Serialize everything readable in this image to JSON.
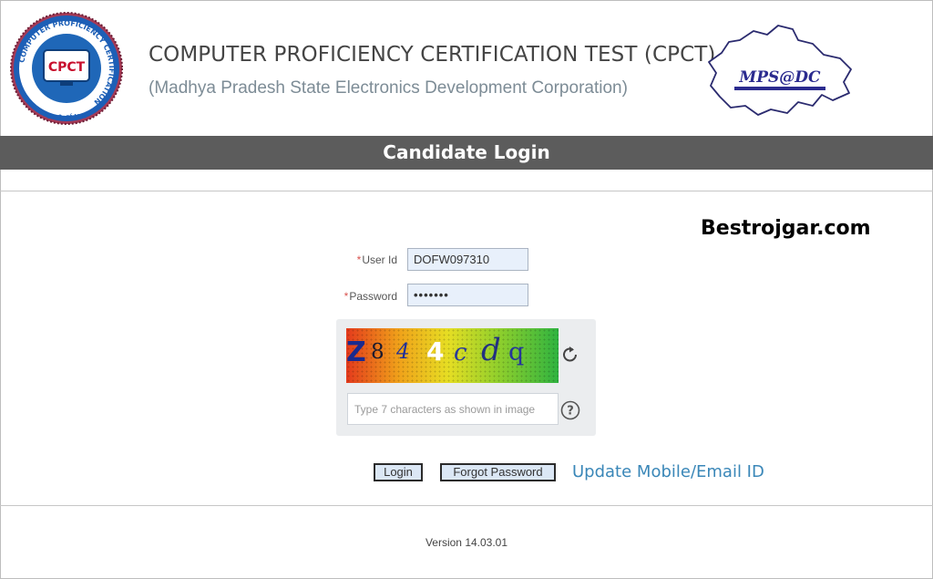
{
  "header": {
    "title": "COMPUTER PROFICIENCY CERTIFICATION TEST (CPCT)",
    "subtitle": "(Madhya Pradesh State Electronics Development Corporation)",
    "left_logo": {
      "ring_text": "COMPUTER PROFICIENCY CERTIFICATION",
      "bottom_text": "Govt. of M.P.",
      "acronym": "CPCT"
    },
    "right_logo": {
      "acronym": "MPS@DC"
    }
  },
  "banner": {
    "title": "Candidate Login"
  },
  "watermark": "Bestrojgar.com",
  "form": {
    "user_id": {
      "label": "User Id",
      "required_mark": "*",
      "value": "DOFW097310"
    },
    "password": {
      "label": "Password",
      "required_mark": "*",
      "value": "•••••••"
    },
    "captcha": {
      "characters": [
        "Z",
        "8",
        "4",
        "4",
        "c",
        "d",
        "q"
      ],
      "input_placeholder": "Type 7 characters as shown in image",
      "input_value": ""
    },
    "buttons": {
      "login": "Login",
      "forgot_password": "Forgot Password",
      "update_link": "Update Mobile/Email ID"
    }
  },
  "footer": {
    "version": "Version 14.03.01"
  },
  "colors": {
    "banner_bg": "#5c5c5c",
    "required": "#d9534f",
    "link": "#3a87b8",
    "input_bg": "#e8f0fb",
    "subtitle": "#7d8c96"
  }
}
